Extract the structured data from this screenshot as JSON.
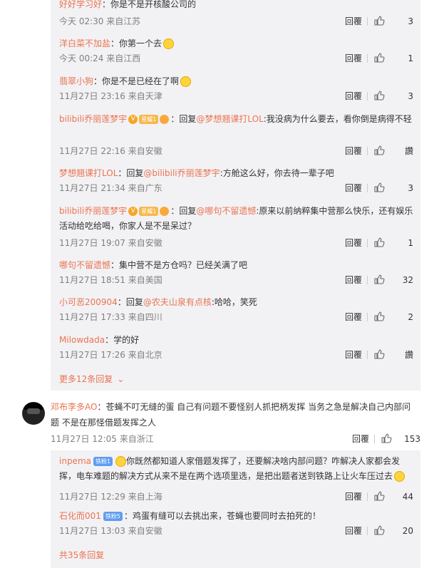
{
  "reply_label": "回覆",
  "top_thread": {
    "replies": [
      {
        "user": "好好学习好",
        "text": "：你是不是开核酸公司的",
        "time": "今天 02:30 来自江苏",
        "likes": "3"
      },
      {
        "user": "洋白菜不加盐",
        "text": "：你第一个去",
        "time": "今天 00:24 来自江西",
        "likes": "1",
        "emoji": "grin-emoji"
      },
      {
        "user": "翡翠小狗",
        "text": "：你是不是已经在了啊",
        "time": "11月27日 23:16 来自天津",
        "likes": "3",
        "emoji": "dog-emoji"
      },
      {
        "user": "bilibili乔丽莲梦宇",
        "badge": "星耀1",
        "reply_to_prefix": "：回复",
        "reply_to": "@梦想翘课打LOL",
        "text": ":我没病为什么要去，看你倒是病得不轻",
        "time": "11月27日 22:16 来自安徽",
        "likes": "讚"
      },
      {
        "user": "梦想翘课打LOL",
        "reply_to_prefix": "：回复",
        "reply_to": "@bilibili乔丽莲梦宇",
        "text": ":方舱这么好，你去待一辈子吧",
        "time": "11月27日 21:34 来自广东",
        "likes": "3"
      },
      {
        "user": "bilibili乔丽莲梦宇",
        "badge": "星耀1",
        "reply_to_prefix": "：回复",
        "reply_to": "@哪句不留遗憾",
        "text": ":原来以前纳粹集中营那么快乐，还有娱乐活动给吃给喝，你家人是不是呆过？",
        "time": "11月27日 19:07 来自安徽",
        "likes": "1"
      },
      {
        "user": "哪句不留遗憾",
        "text": "：集中营不是方仓吗？已经关满了吧",
        "time": "11月27日 18:51 来自美国",
        "likes": "32"
      },
      {
        "user": "小可恶200904",
        "reply_to_prefix": "：回复",
        "reply_to": "@农夫山泉有点核",
        "text": ":哈哈，笑死",
        "time": "11月27日 17:33 来自四川",
        "likes": "2"
      },
      {
        "user": "Milowdada",
        "text": "：学的好",
        "time": "11月27日 17:26 来自北京",
        "likes": "讚"
      }
    ],
    "more_label": "更多12条回复"
  },
  "main_comment": {
    "user": "邓布李多AO",
    "text": "：苍蝇不叮无缝的蛋 自己有问题不要怪别人抓把柄发挥 当务之急是解决自己内部问题 不是在那怪借题发挥之人",
    "time": "11月27日 12:05 来自浙江",
    "likes": "153"
  },
  "sub_thread": {
    "replies": [
      {
        "user": "inpema",
        "badge": "铁粉1",
        "text": "你既然都知道人家借题发挥了，还要解决啥内部问题？咋解决人家都会发挥，电车难题的解决方式从来不是在两个选项里选，是把出题者送到铁路上让火车压过去",
        "time": "11月27日 12:29 来自上海",
        "likes": "44"
      },
      {
        "user": "石化而001",
        "badge": "铁粉5",
        "text": "：鸡蛋有缝可以去挑出来，苍蝇也要同时去拍死的！",
        "time": "11月27日 13:03 来自安徽",
        "likes": "20"
      }
    ],
    "total_label": "共35条回复"
  },
  "colors": {
    "username": "#eb7350",
    "panel_bg": "#f2f2f5",
    "meta": "#808080"
  }
}
